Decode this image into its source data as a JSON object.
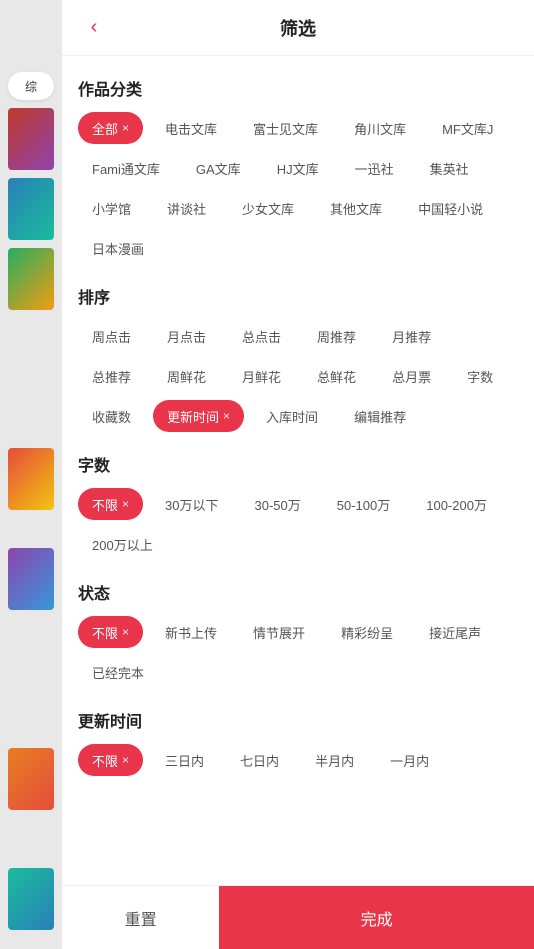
{
  "header": {
    "title": "筛选",
    "back_icon": "‹"
  },
  "sidebar": {
    "tab_label": "综"
  },
  "sections": {
    "category": {
      "title": "作品分类",
      "tags": [
        {
          "label": "全部",
          "active": true,
          "closeable": true
        },
        {
          "label": "电击文库",
          "active": false,
          "closeable": false
        },
        {
          "label": "富士见文库",
          "active": false,
          "closeable": false
        },
        {
          "label": "角川文库",
          "active": false,
          "closeable": false
        },
        {
          "label": "MF文库J",
          "active": false,
          "closeable": false
        },
        {
          "label": "Fami通文库",
          "active": false,
          "closeable": false
        },
        {
          "label": "GA文库",
          "active": false,
          "closeable": false
        },
        {
          "label": "HJ文库",
          "active": false,
          "closeable": false
        },
        {
          "label": "一迅社",
          "active": false,
          "closeable": false
        },
        {
          "label": "集英社",
          "active": false,
          "closeable": false
        },
        {
          "label": "小学馆",
          "active": false,
          "closeable": false
        },
        {
          "label": "讲谈社",
          "active": false,
          "closeable": false
        },
        {
          "label": "少女文库",
          "active": false,
          "closeable": false
        },
        {
          "label": "其他文库",
          "active": false,
          "closeable": false
        },
        {
          "label": "中国轻小说",
          "active": false,
          "closeable": false
        },
        {
          "label": "日本漫画",
          "active": false,
          "closeable": false
        }
      ]
    },
    "sort": {
      "title": "排序",
      "tags": [
        {
          "label": "周点击",
          "active": false,
          "closeable": false
        },
        {
          "label": "月点击",
          "active": false,
          "closeable": false
        },
        {
          "label": "总点击",
          "active": false,
          "closeable": false
        },
        {
          "label": "周推荐",
          "active": false,
          "closeable": false
        },
        {
          "label": "月推荐",
          "active": false,
          "closeable": false
        },
        {
          "label": "总推荐",
          "active": false,
          "closeable": false
        },
        {
          "label": "周鲜花",
          "active": false,
          "closeable": false
        },
        {
          "label": "月鲜花",
          "active": false,
          "closeable": false
        },
        {
          "label": "总鲜花",
          "active": false,
          "closeable": false
        },
        {
          "label": "总月票",
          "active": false,
          "closeable": false
        },
        {
          "label": "字数",
          "active": false,
          "closeable": false
        },
        {
          "label": "收藏数",
          "active": false,
          "closeable": false
        },
        {
          "label": "更新时间",
          "active": true,
          "closeable": true
        },
        {
          "label": "入库时间",
          "active": false,
          "closeable": false
        },
        {
          "label": "编辑推荐",
          "active": false,
          "closeable": false
        }
      ]
    },
    "wordcount": {
      "title": "字数",
      "tags": [
        {
          "label": "不限",
          "active": true,
          "closeable": true
        },
        {
          "label": "30万以下",
          "active": false,
          "closeable": false
        },
        {
          "label": "30-50万",
          "active": false,
          "closeable": false
        },
        {
          "label": "50-100万",
          "active": false,
          "closeable": false
        },
        {
          "label": "100-200万",
          "active": false,
          "closeable": false
        },
        {
          "label": "200万以上",
          "active": false,
          "closeable": false
        }
      ]
    },
    "status": {
      "title": "状态",
      "tags": [
        {
          "label": "不限",
          "active": true,
          "closeable": true
        },
        {
          "label": "新书上传",
          "active": false,
          "closeable": false
        },
        {
          "label": "情节展开",
          "active": false,
          "closeable": false
        },
        {
          "label": "精彩纷呈",
          "active": false,
          "closeable": false
        },
        {
          "label": "接近尾声",
          "active": false,
          "closeable": false
        },
        {
          "label": "已经完本",
          "active": false,
          "closeable": false
        }
      ]
    },
    "update_time": {
      "title": "更新时间",
      "tags": [
        {
          "label": "不限",
          "active": true,
          "closeable": true
        },
        {
          "label": "三日内",
          "active": false,
          "closeable": false
        },
        {
          "label": "七日内",
          "active": false,
          "closeable": false
        },
        {
          "label": "半月内",
          "active": false,
          "closeable": false
        },
        {
          "label": "一月内",
          "active": false,
          "closeable": false
        }
      ]
    }
  },
  "buttons": {
    "reset": "重置",
    "confirm": "完成"
  }
}
